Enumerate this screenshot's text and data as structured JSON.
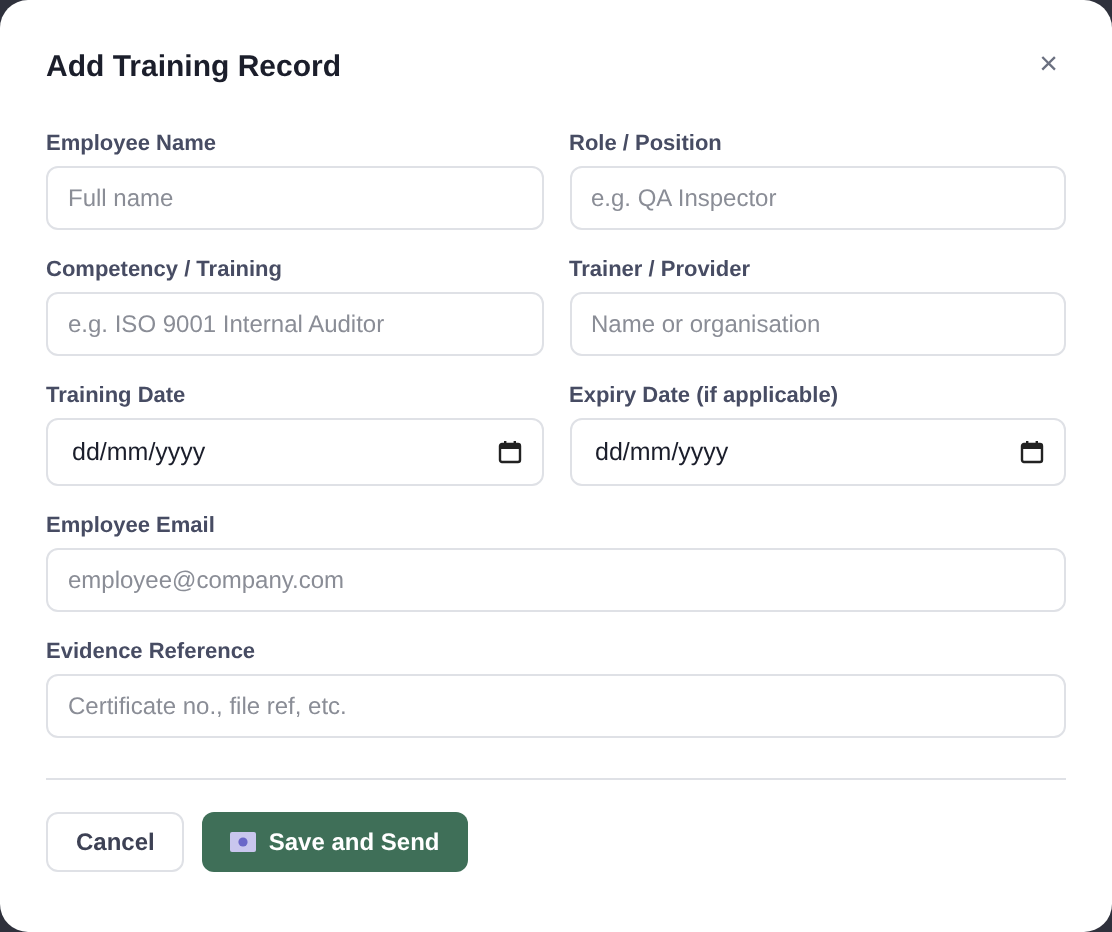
{
  "dialog": {
    "title": "Add Training Record",
    "close": "×"
  },
  "rows": [
    [
      {
        "label": "Employee Name",
        "kind": "text",
        "placeholder": "Full name"
      },
      {
        "label": "Role / Position",
        "kind": "text",
        "placeholder": "e.g. QA Inspector"
      }
    ],
    [
      {
        "label": "Competency / Training",
        "kind": "text",
        "placeholder": "e.g. ISO 9001 Internal Auditor"
      },
      {
        "label": "Trainer / Provider",
        "kind": "text",
        "placeholder": "Name or organisation"
      }
    ],
    [
      {
        "label": "Training Date",
        "kind": "date",
        "placeholder": "dd/mm/yyyy"
      },
      {
        "label": "Expiry Date (if applicable)",
        "kind": "date",
        "placeholder": "dd/mm/yyyy"
      }
    ],
    [
      {
        "label": "Employee Email",
        "kind": "text",
        "placeholder": "employee@company.com"
      }
    ],
    [
      {
        "label": "Evidence Reference",
        "kind": "text",
        "placeholder": "Certificate no., file ref, etc."
      }
    ]
  ],
  "buttons": [
    {
      "label": "Cancel",
      "kind": "secondary"
    },
    {
      "label": "Save and Send",
      "kind": "primary"
    }
  ]
}
